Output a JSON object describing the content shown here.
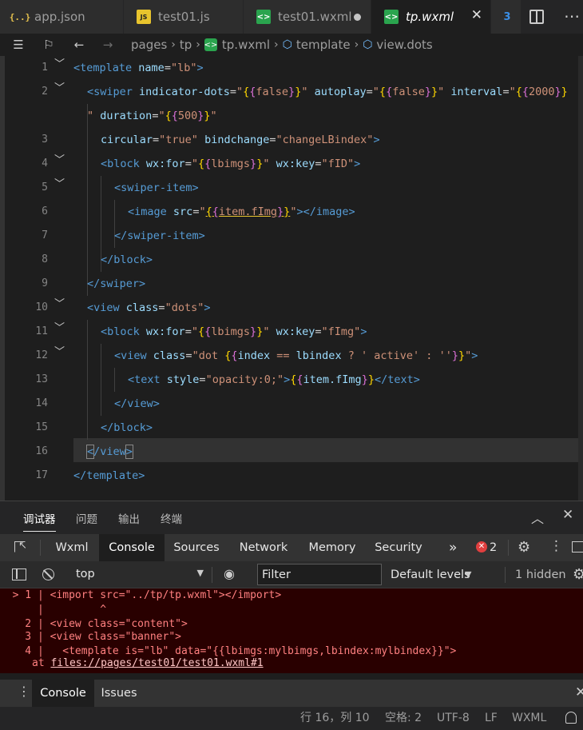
{
  "tabs": [
    {
      "icon": "{..}",
      "label": "app.json"
    },
    {
      "icon": "JS",
      "label": "test01.js"
    },
    {
      "icon": "<>",
      "label": "test01.wxml"
    },
    {
      "icon": "<>",
      "label": "tp.wxml"
    },
    {
      "icon": "3"
    }
  ],
  "breadcrumb": {
    "crumbs": [
      "pages",
      "tp",
      "tp.wxml",
      "template",
      "view.dots"
    ]
  },
  "editor": {
    "lines": [
      {
        "n": "1",
        "fold": true
      },
      {
        "n": "2",
        "fold": true
      },
      {
        "n": "",
        "fold": false
      },
      {
        "n": "3",
        "fold": false
      },
      {
        "n": "4",
        "fold": true
      },
      {
        "n": "5",
        "fold": true
      },
      {
        "n": "6",
        "fold": false
      },
      {
        "n": "7",
        "fold": false
      },
      {
        "n": "8",
        "fold": false
      },
      {
        "n": "9",
        "fold": false
      },
      {
        "n": "10",
        "fold": true
      },
      {
        "n": "11",
        "fold": true
      },
      {
        "n": "12",
        "fold": true
      },
      {
        "n": "13",
        "fold": false
      },
      {
        "n": "14",
        "fold": false
      },
      {
        "n": "15",
        "fold": false
      },
      {
        "n": "16",
        "fold": false
      },
      {
        "n": "17",
        "fold": false
      }
    ]
  },
  "panel": {
    "tabs": [
      "调试器",
      "问题",
      "输出",
      "终端"
    ],
    "up_glyph": "︿",
    "close_glyph": "✕"
  },
  "devtools": {
    "tabs": [
      "Wxml",
      "Console",
      "Sources",
      "Network",
      "Memory",
      "Security"
    ],
    "more_glyph": "»",
    "error_count": "2",
    "context": "top",
    "filter_placeholder": "Filter",
    "levels": "Default levels",
    "hidden": "1 hidden"
  },
  "console": {
    "lines": [
      "  > 1 | <import src=\"../tp/tp.wxml\"></import>",
      "      |         ^",
      "    2 | <view class=\"content\">",
      "    3 | <view class=\"banner\">",
      "    4 |   <template is=\"lb\" data=\"{{lbimgs:mylbimgs,lbindex:mylbindex}}\">"
    ],
    "at_prefix": "at ",
    "link": "files://pages/test01/test01.wxml#1"
  },
  "drawer": {
    "tabs": [
      "Console",
      "Issues"
    ]
  },
  "statusbar": {
    "position": "行 16，列 10",
    "spaces": "空格: 2",
    "encoding": "UTF-8",
    "eol": "LF",
    "language": "WXML"
  },
  "colors": {
    "tag": "#569cd6",
    "attr": "#9cdcfe",
    "string": "#ce9178",
    "bracket1": "#ffd700",
    "bracket2": "#da70d6",
    "bracket3": "#179fff",
    "error_bg": "#290000",
    "error_text": "#ff8080"
  }
}
